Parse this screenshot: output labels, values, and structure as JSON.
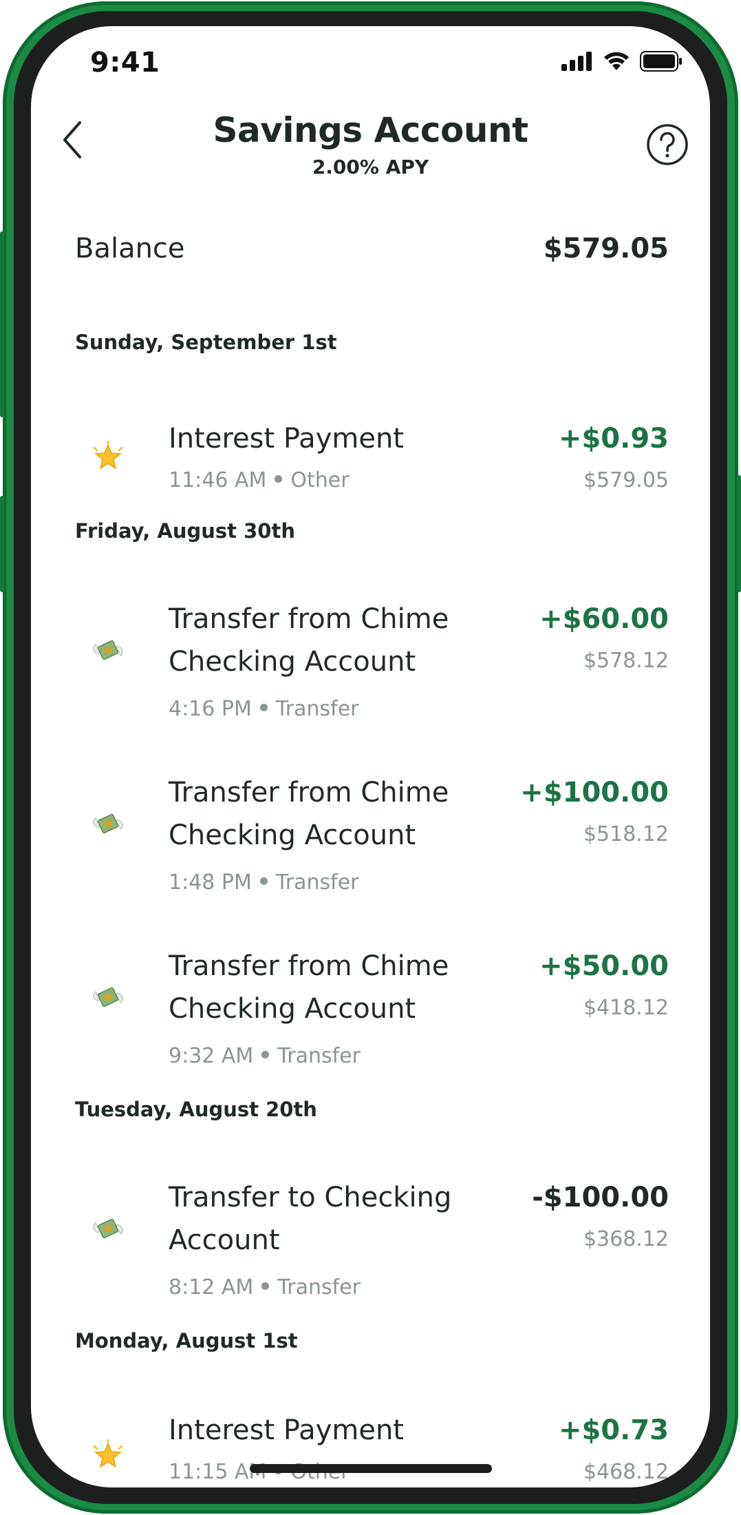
{
  "status_bar": {
    "time": "9:41"
  },
  "header": {
    "title": "Savings Account",
    "subtitle": "2.00% APY",
    "back_icon": "chevron-left-icon",
    "help_icon": "question-circle-icon"
  },
  "balance": {
    "label": "Balance",
    "value": "$579.05"
  },
  "colors": {
    "accent": "#1c7346",
    "frame": "#1a8a44",
    "muted": "#8a9690",
    "text": "#1f2a26"
  },
  "groups": [
    {
      "date": "Sunday, September 1st",
      "transactions": [
        {
          "icon": "star-icon",
          "title": "Interest Payment",
          "time": "11:46 AM",
          "category": "Other",
          "amount": "+$0.93",
          "running_balance": "$579.05"
        }
      ]
    },
    {
      "date": "Friday, August 30th",
      "transactions": [
        {
          "icon": "money-wings-icon",
          "title": "Transfer from Chime Checking Account",
          "time": "4:16 PM",
          "category": "Transfer",
          "amount": "+$60.00",
          "running_balance": "$578.12"
        },
        {
          "icon": "money-wings-icon",
          "title": "Transfer from Chime Checking Account",
          "time": "1:48 PM",
          "category": "Transfer",
          "amount": "+$100.00",
          "running_balance": "$518.12"
        },
        {
          "icon": "money-wings-icon",
          "title": "Transfer from Chime Checking Account",
          "time": "9:32 AM",
          "category": "Transfer",
          "amount": "+$50.00",
          "running_balance": "$418.12"
        }
      ]
    },
    {
      "date": "Tuesday, August 20th",
      "transactions": [
        {
          "icon": "money-wings-icon",
          "title": "Transfer to Checking Account",
          "time": "8:12 AM",
          "category": "Transfer",
          "amount": "-$100.00",
          "running_balance": "$368.12"
        }
      ]
    },
    {
      "date": "Monday, August 1st",
      "transactions": [
        {
          "icon": "star-icon",
          "title": "Interest Payment",
          "time": "11:15 AM",
          "category": "Other",
          "amount": "+$0.73",
          "running_balance": "$468.12"
        }
      ]
    }
  ]
}
